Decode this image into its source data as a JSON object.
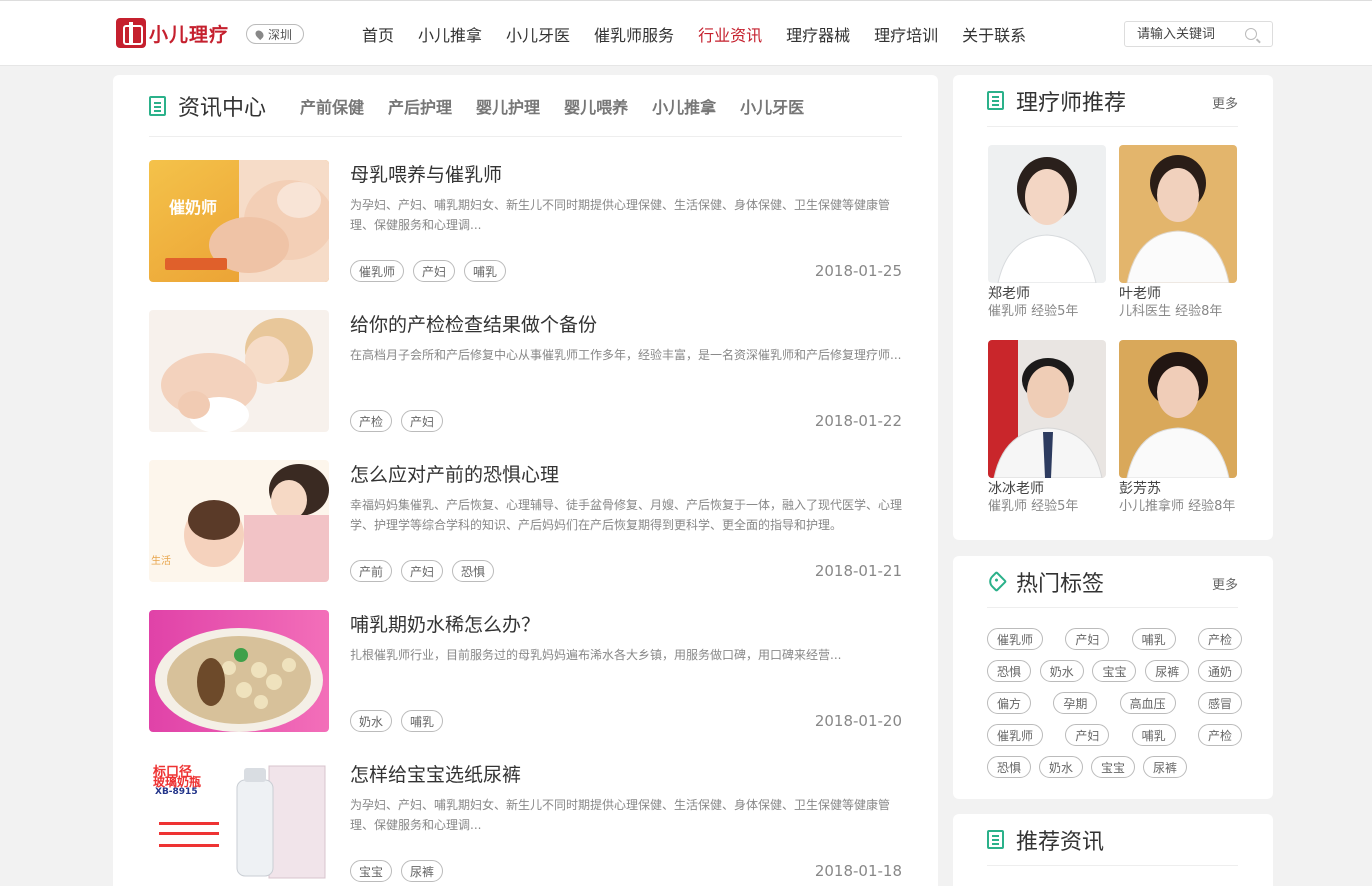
{
  "logo": {
    "text": "小儿理疗"
  },
  "city": {
    "name": "深圳"
  },
  "nav": {
    "items": [
      "首页",
      "小儿推拿",
      "小儿牙医",
      "催乳师服务",
      "行业资讯",
      "理疗器械",
      "理疗培训",
      "关于联系"
    ],
    "active": "行业资讯"
  },
  "search": {
    "placeholder": "请输入关键词"
  },
  "main": {
    "title": "资讯中心",
    "tabs": [
      "产前保健",
      "产后护理",
      "婴儿护理",
      "婴儿喂养",
      "小儿推拿",
      "小儿牙医"
    ],
    "articles": [
      {
        "title": "母乳喂养与催乳师",
        "desc": "为孕妇、产妇、哺乳期妇女、新生儿不同时期提供心理保健、生活保健、身体保健、卫生保健等健康管理、保健服务和心理调...",
        "tags": [
          "催乳师",
          "产妇",
          "哺乳"
        ],
        "date": "2018-01-25",
        "thumb_text": "催奶师"
      },
      {
        "title": "给你的产检检查结果做个备份",
        "desc": "在高档月子会所和产后修复中心从事催乳师工作多年，经验丰富，是一名资深催乳师和产后修复理疗师...",
        "tags": [
          "产检",
          "产妇"
        ],
        "date": "2018-01-22"
      },
      {
        "title": "怎么应对产前的恐惧心理",
        "desc": "幸福妈妈集催乳、产后恢复、心理辅导、徒手盆骨修复、月嫂、产后恢复于一体，融入了现代医学、心理学、护理学等综合学科的知识、产后妈妈们在产后恢复期得到更科学、更全面的指导和护理。",
        "tags": [
          "产前",
          "产妇",
          "恐惧"
        ],
        "date": "2018-01-21",
        "thumb_text": "生活"
      },
      {
        "title": "哺乳期奶水稀怎么办？",
        "desc": "扎根催乳师行业，目前服务过的母乳妈妈遍布浠水各大乡镇，用服务做口碑，用口碑来经营...",
        "tags": [
          "奶水",
          "哺乳"
        ],
        "date": "2018-01-20"
      },
      {
        "title": "怎样给宝宝选纸尿裤",
        "desc": "为孕妇、产妇、哺乳期妇女、新生儿不同时期提供心理保健、生活保健、身体保健、卫生保健等健康管理、保健服务和心理调...",
        "tags": [
          "宝宝",
          "尿裤"
        ],
        "date": "2018-01-18",
        "thumb_text": "标口径",
        "thumb_text2": "玻璃奶瓶",
        "thumb_text3": "XB-8915"
      }
    ]
  },
  "therapists": {
    "title": "理疗师推荐",
    "more": "更多",
    "items": [
      {
        "name": "郑老师",
        "info": "催乳师 经验5年"
      },
      {
        "name": "叶老师",
        "info": "儿科医生 经验8年"
      },
      {
        "name": "冰冰老师",
        "info": "催乳师 经验5年"
      },
      {
        "name": "彭芳苏",
        "info": "小儿推拿师 经验8年"
      }
    ]
  },
  "hot_tags": {
    "title": "热门标签",
    "more": "更多",
    "rows": [
      [
        "催乳师",
        "产妇",
        "哺乳",
        "产检"
      ],
      [
        "恐惧",
        "奶水",
        "宝宝",
        "尿裤",
        "通奶"
      ],
      [
        "偏方",
        "孕期",
        "高血压",
        "感冒"
      ],
      [
        "催乳师",
        "产妇",
        "哺乳",
        "产检"
      ],
      [
        "恐惧",
        "奶水",
        "宝宝",
        "尿裤"
      ]
    ]
  },
  "recommend": {
    "title": "推荐资讯"
  },
  "colors": {
    "brand": "#c5202e",
    "accent": "#2bb18a"
  }
}
